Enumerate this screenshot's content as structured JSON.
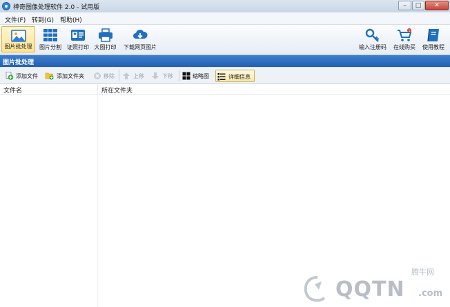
{
  "window": {
    "title": "神奇图像处理软件 2.0 - 试用版",
    "controls": {
      "minimize": "–",
      "maximize": "□",
      "close": "✕"
    }
  },
  "menu": [
    "文件(F)",
    "转到(G)",
    "帮助(H)"
  ],
  "toolbar": {
    "left": [
      {
        "label": "图片批处理",
        "icon": "image-icon",
        "active": true
      },
      {
        "label": "图片分割",
        "icon": "grid-icon"
      },
      {
        "label": "证照打印",
        "icon": "id-card-icon"
      },
      {
        "label": "大图打印",
        "icon": "printer-icon"
      },
      {
        "label": "下载网页图片",
        "icon": "cloud-download-icon"
      }
    ],
    "right": [
      {
        "label": "输入注册码",
        "icon": "key-icon"
      },
      {
        "label": "在线购买",
        "icon": "cart-icon",
        "badge": "1"
      },
      {
        "label": "使用教程",
        "icon": "book-icon"
      }
    ]
  },
  "section": {
    "title": "图片批处理"
  },
  "actions": [
    {
      "label": "添加文件",
      "icon": "add-file-icon"
    },
    {
      "label": "添加文件夹",
      "icon": "add-folder-icon"
    },
    {
      "label": "移除",
      "icon": "remove-icon",
      "disabled": true
    },
    {
      "label": "上移",
      "icon": "arrow-up-icon",
      "disabled": true
    },
    {
      "label": "下移",
      "icon": "arrow-down-icon",
      "disabled": true
    },
    {
      "label": "缩略图",
      "icon": "thumbnail-icon"
    },
    {
      "label": "详细信息",
      "icon": "details-list-icon",
      "pressed": true
    }
  ],
  "list": {
    "columns": [
      "文件名",
      "所在文件夹"
    ],
    "rows": []
  },
  "watermark": {
    "cn": "腾牛网",
    "brand": "QQTN",
    "domain": ".com"
  },
  "colors": {
    "header_blue": "#2d6cc0",
    "active_tool": "#ffe190",
    "add_green": "#3aa63a"
  }
}
